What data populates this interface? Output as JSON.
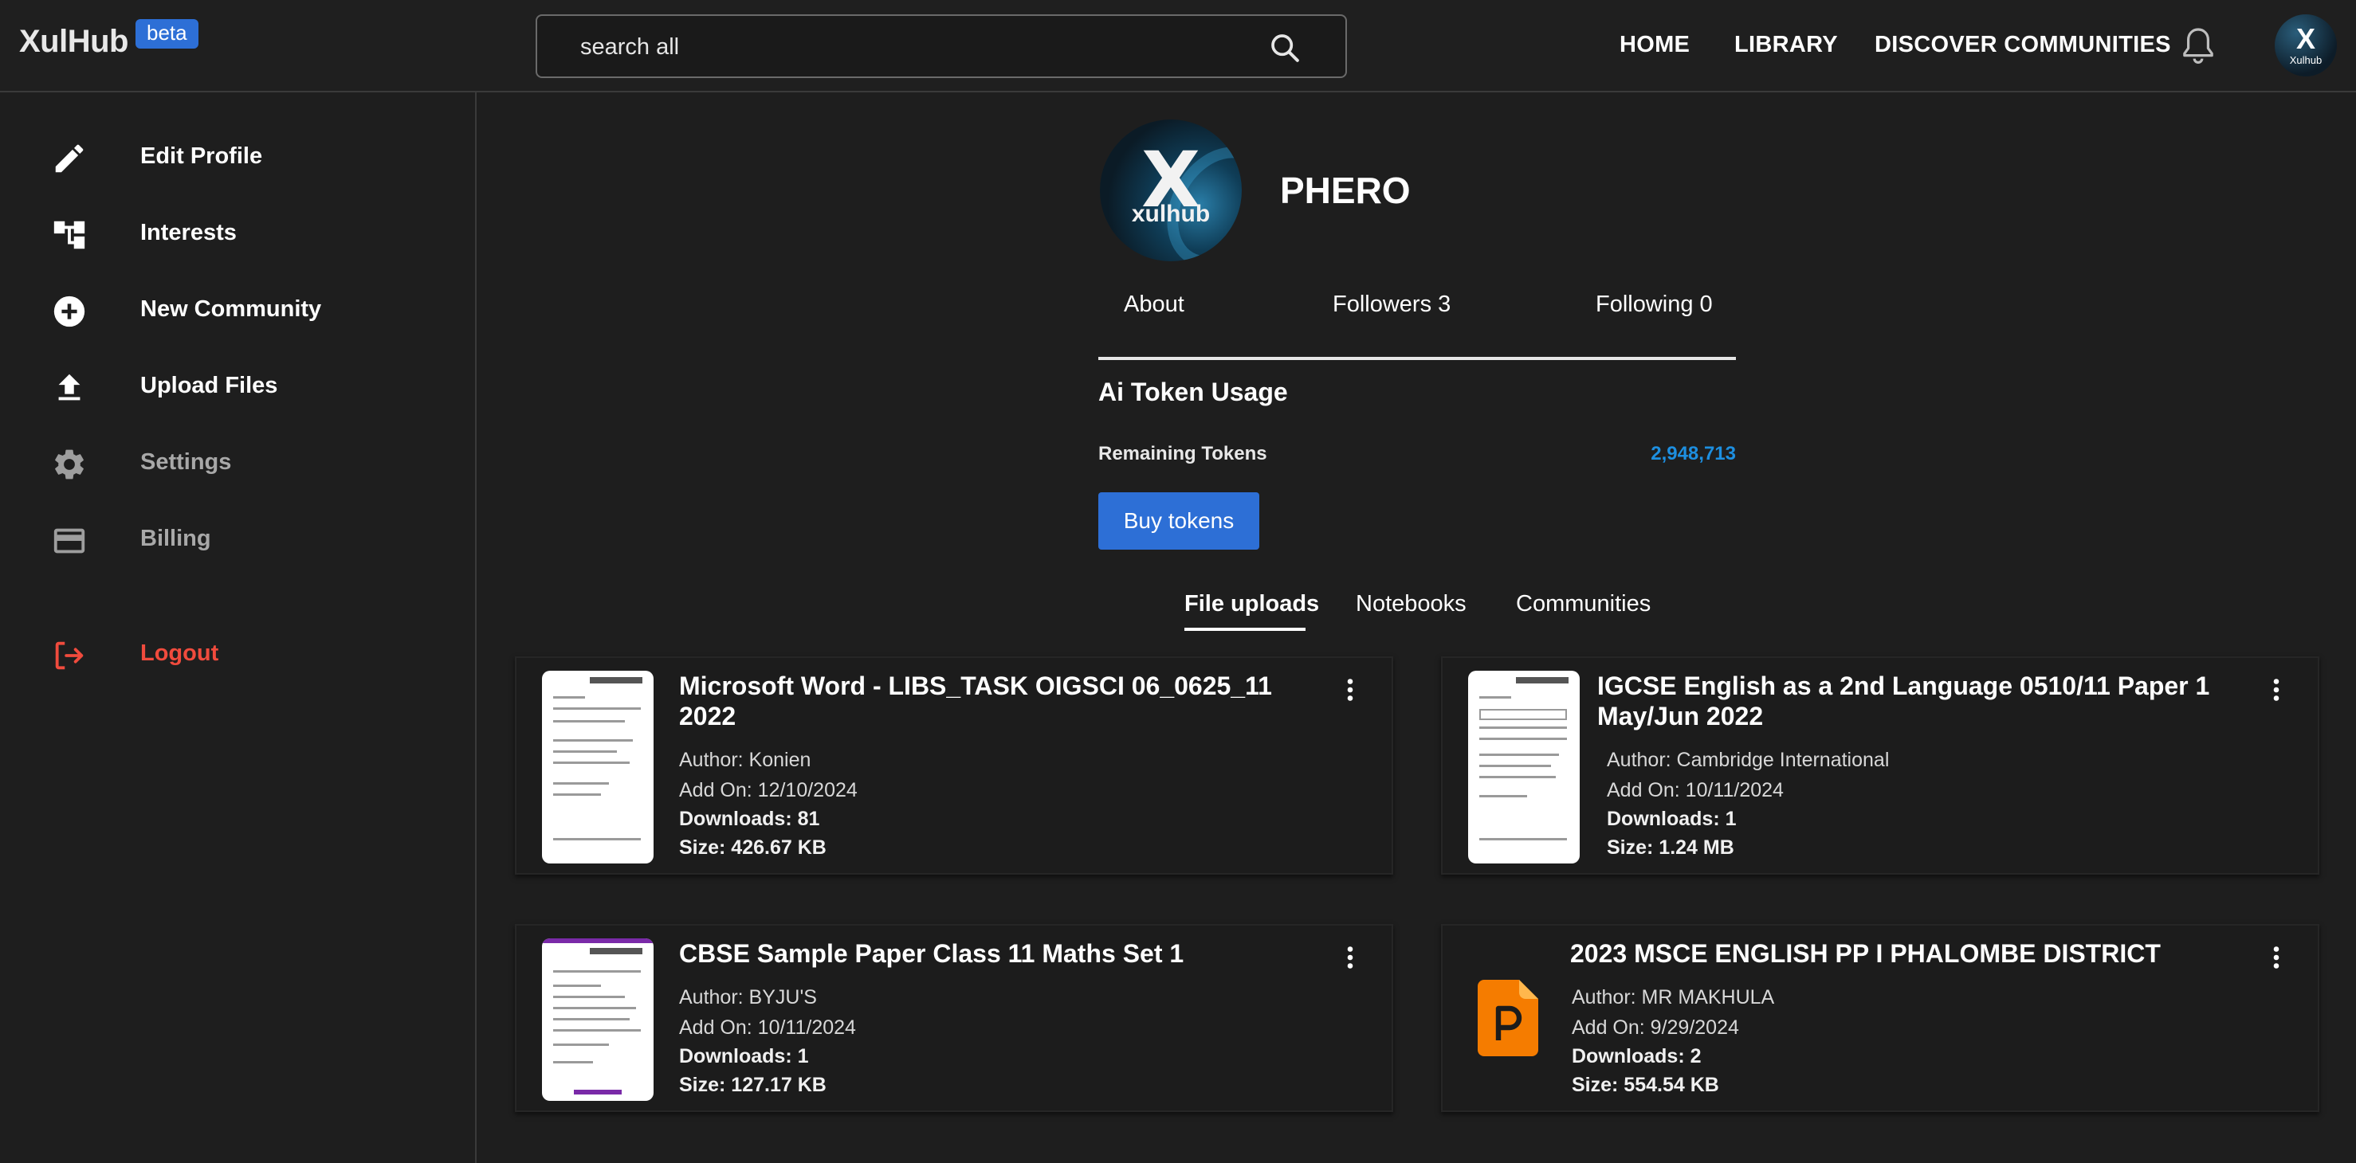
{
  "header": {
    "logo": "XulHub",
    "badge": "beta",
    "search_placeholder": "search all",
    "nav": [
      "HOME",
      "LIBRARY",
      "DISCOVER COMMUNITIES"
    ],
    "avatar_mark": "X",
    "avatar_text": "Xulhub"
  },
  "sidebar": {
    "items": [
      {
        "label": "Edit Profile",
        "icon": "pencil-icon"
      },
      {
        "label": "Interests",
        "icon": "hierarchy-icon"
      },
      {
        "label": "New Community",
        "icon": "add-circle-icon"
      },
      {
        "label": "Upload Files",
        "icon": "upload-icon"
      },
      {
        "label": "Settings",
        "icon": "gear-icon"
      },
      {
        "label": "Billing",
        "icon": "credit-card-icon"
      }
    ],
    "logout": "Logout"
  },
  "profile": {
    "avatar_mark": "X",
    "avatar_text": "xulhub",
    "username": "PHERO",
    "about": "About",
    "followers": "Followers 3",
    "following": "Following 0"
  },
  "tokens": {
    "title": "Ai Token Usage",
    "remaining_label": "Remaining Tokens",
    "remaining_value": "2,948,713",
    "buy_label": "Buy tokens"
  },
  "tabs": [
    "File uploads",
    "Notebooks",
    "Communities"
  ],
  "files": [
    {
      "title_l1": "Microsoft Word - LIBS_TASK OIGSCI 06_0625_11",
      "title_l2": "2022",
      "author": "Author: Konien",
      "added": "Add On: 12/10/2024",
      "downloads": "Downloads: 81",
      "size": "Size: 426.67 KB"
    },
    {
      "title_l1": "IGCSE English as a 2nd Language 0510/11 Paper 1",
      "title_l2": "May/Jun 2022",
      "author": "Author: Cambridge International",
      "added": "Add On: 10/11/2024",
      "downloads": "Downloads: 1",
      "size": "Size: 1.24 MB"
    },
    {
      "title_l1": "CBSE Sample Paper Class 11 Maths Set 1",
      "title_l2": "",
      "author": "Author: BYJU'S",
      "added": "Add On: 10/11/2024",
      "downloads": "Downloads: 1",
      "size": "Size: 127.17 KB"
    },
    {
      "title_l1": "2023 MSCE ENGLISH PP I PHALOMBE DISTRICT",
      "title_l2": "",
      "author": "Author: MR MAKHULA",
      "added": "Add On: 9/29/2024",
      "downloads": "Downloads: 2",
      "size": "Size: 554.54 KB"
    }
  ],
  "colors": {
    "accent": "#2d6fd6",
    "token_value": "#1d8fe0",
    "logout": "#f04b3d",
    "ppt": "#f57c00"
  }
}
